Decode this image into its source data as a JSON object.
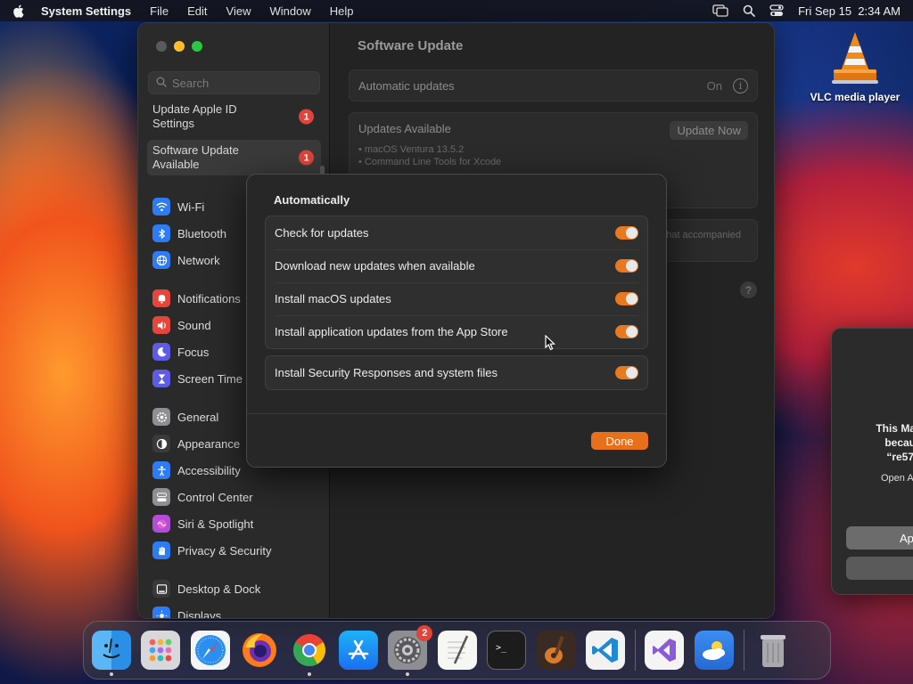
{
  "menubar": {
    "app_name": "System Settings",
    "menus": [
      "File",
      "Edit",
      "View",
      "Window",
      "Help"
    ],
    "datetime": "Fri Sep 15  2:34 AM"
  },
  "desktop": {
    "icon_label": "VLC media player"
  },
  "window": {
    "search_placeholder": "Search",
    "notices": [
      {
        "label": "Update Apple ID Settings",
        "badge": "1"
      },
      {
        "label": "Software Update Available",
        "badge": "1"
      }
    ],
    "sidebar_groups": [
      [
        {
          "label": "Wi-Fi",
          "icon": "wifi-icon",
          "color": "#2d7cf6"
        },
        {
          "label": "Bluetooth",
          "icon": "bluetooth-icon",
          "color": "#2d7cf6"
        },
        {
          "label": "Network",
          "icon": "globe-icon",
          "color": "#2d7cf6"
        }
      ],
      [
        {
          "label": "Notifications",
          "icon": "bell-icon",
          "color": "#e5453a"
        },
        {
          "label": "Sound",
          "icon": "speaker-icon",
          "color": "#e5453a"
        },
        {
          "label": "Focus",
          "icon": "moon-icon",
          "color": "#5e5ce6"
        },
        {
          "label": "Screen Time",
          "icon": "hourglass-icon",
          "color": "#5e5ce6"
        }
      ],
      [
        {
          "label": "General",
          "icon": "gear-icon",
          "color": "#8e8e93"
        },
        {
          "label": "Appearance",
          "icon": "appearance-icon",
          "color": "#3a3a3c"
        },
        {
          "label": "Accessibility",
          "icon": "accessibility-icon",
          "color": "#2d7cf6"
        },
        {
          "label": "Control Center",
          "icon": "control-center-icon",
          "color": "#8e8e93"
        },
        {
          "label": "Siri & Spotlight",
          "icon": "siri-icon",
          "color": "#b14dd6"
        },
        {
          "label": "Privacy & Security",
          "icon": "hand-icon",
          "color": "#2d7cf6"
        }
      ],
      [
        {
          "label": "Desktop & Dock",
          "icon": "dock-icon",
          "color": "#3a3a3c"
        },
        {
          "label": "Displays",
          "icon": "display-icon",
          "color": "#2d7cf6"
        }
      ]
    ],
    "main": {
      "title": "Software Update",
      "automatic_updates_label": "Automatic updates",
      "automatic_updates_value": "On",
      "updates_available_label": "Updates Available",
      "update_now_label": "Update Now",
      "updates": [
        "• macOS Ventura 13.5.2",
        "• Command Line Tools for Xcode"
      ],
      "license_fragment": "that accompanied"
    }
  },
  "sheet": {
    "title": "Automatically",
    "group1": [
      {
        "label": "Check for updates",
        "on": true
      },
      {
        "label": "Download new updates when available",
        "on": true
      },
      {
        "label": "Install macOS updates",
        "on": true
      },
      {
        "label": "Install application updates from the App Store",
        "on": true
      }
    ],
    "group2": [
      {
        "label": "Install Security Responses and system files",
        "on": true
      }
    ],
    "done_label": "Done"
  },
  "alert": {
    "line1": "This Mac c",
    "line2": "becaus",
    "line3": "“re579",
    "line4": "Open A",
    "button1": "Ap"
  },
  "dock": {
    "apps": [
      {
        "name": "Finder",
        "running": true
      },
      {
        "name": "Launchpad",
        "running": false
      },
      {
        "name": "Safari",
        "running": false
      },
      {
        "name": "Firefox",
        "running": false
      },
      {
        "name": "Google Chrome",
        "running": true
      },
      {
        "name": "App Store",
        "running": false
      },
      {
        "name": "System Settings",
        "running": true,
        "badge": "2"
      },
      {
        "name": "TextEdit",
        "running": false
      },
      {
        "name": "Terminal",
        "running": false
      },
      {
        "name": "GarageBand",
        "running": false
      },
      {
        "name": "Visual Studio Code",
        "running": false
      },
      {
        "name": "Visual Studio",
        "running": false
      },
      {
        "name": "Weather",
        "running": false
      },
      {
        "name": "Trash",
        "running": false
      }
    ]
  }
}
